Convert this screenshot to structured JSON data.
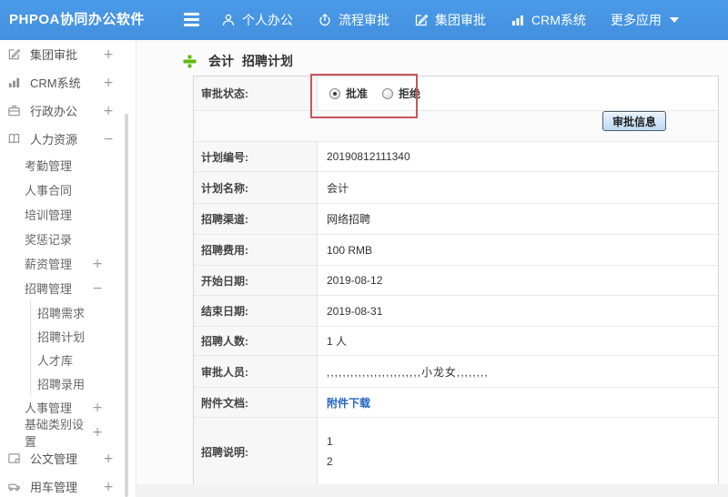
{
  "colors": {
    "topbar_blue": "#4897e4",
    "highlight_box_red": "#c4575c",
    "link_blue": "#2366c2",
    "plus_green": "#63b90f",
    "button_face": "#cfe3f7"
  },
  "header": {
    "logo": "PHPOA协同办公软件",
    "nav": [
      {
        "label": "个人办公",
        "icon": "user-icon"
      },
      {
        "label": "流程审批",
        "icon": "workflow-icon"
      },
      {
        "label": "集团审批",
        "icon": "edit-icon"
      },
      {
        "label": "CRM系统",
        "icon": "bar-chart-icon"
      },
      {
        "label": "更多应用",
        "icon": "caret-down-icon"
      }
    ]
  },
  "sidebar": {
    "items": [
      {
        "label": "集团审批",
        "level": 1,
        "icon": "edit-icon",
        "expand": "+"
      },
      {
        "label": "CRM系统",
        "level": 1,
        "icon": "bar-chart-icon",
        "expand": "+"
      },
      {
        "label": "行政办公",
        "level": 1,
        "icon": "briefcase-icon",
        "expand": "+"
      },
      {
        "label": "人力资源",
        "level": 1,
        "icon": "book-icon",
        "expand": "−"
      },
      {
        "label": "考勤管理",
        "level": 2
      },
      {
        "label": "人事合同",
        "level": 2
      },
      {
        "label": "培训管理",
        "level": 2
      },
      {
        "label": "奖惩记录",
        "level": 2
      },
      {
        "label": "薪资管理",
        "level": 2,
        "expand": "+"
      },
      {
        "label": "招聘管理",
        "level": 2,
        "expand": "−"
      },
      {
        "label": "招聘需求",
        "level": 3
      },
      {
        "label": "招聘计划",
        "level": 3
      },
      {
        "label": "人才库",
        "level": 3
      },
      {
        "label": "招聘录用",
        "level": 3
      },
      {
        "label": "人事管理",
        "level": 2,
        "expand": "+"
      },
      {
        "label": "基础类别设置",
        "level": 2,
        "expand": "+"
      },
      {
        "label": "公文管理",
        "level": 1,
        "icon": "document-icon",
        "expand": "+"
      },
      {
        "label": "用车管理",
        "level": 1,
        "icon": "car-icon",
        "expand": "+"
      }
    ]
  },
  "main": {
    "title_name": "会计",
    "title_type": "招聘计划",
    "approval": {
      "label": "审批状态:",
      "options": [
        {
          "label": "批准",
          "checked": true
        },
        {
          "label": "拒绝",
          "checked": false
        }
      ]
    },
    "approval_info_button": "审批信息",
    "fields": [
      {
        "label": "计划编号:",
        "value": "20190812111340"
      },
      {
        "label": "计划名称:",
        "value": "会计"
      },
      {
        "label": "招聘渠道:",
        "value": "网络招聘"
      },
      {
        "label": "招聘费用:",
        "value": "100 RMB"
      },
      {
        "label": "开始日期:",
        "value": "2019-08-12"
      },
      {
        "label": "结束日期:",
        "value": "2019-08-31"
      },
      {
        "label": "招聘人数:",
        "value": "1 人"
      },
      {
        "label": "审批人员:",
        "value": ",,,,,,,,,,,,,,,,,,,,,,,,小龙女,,,,,,,,"
      },
      {
        "label": "附件文档:",
        "value": "附件下载"
      },
      {
        "label": "招聘说明:",
        "value": "1\n2"
      }
    ]
  }
}
